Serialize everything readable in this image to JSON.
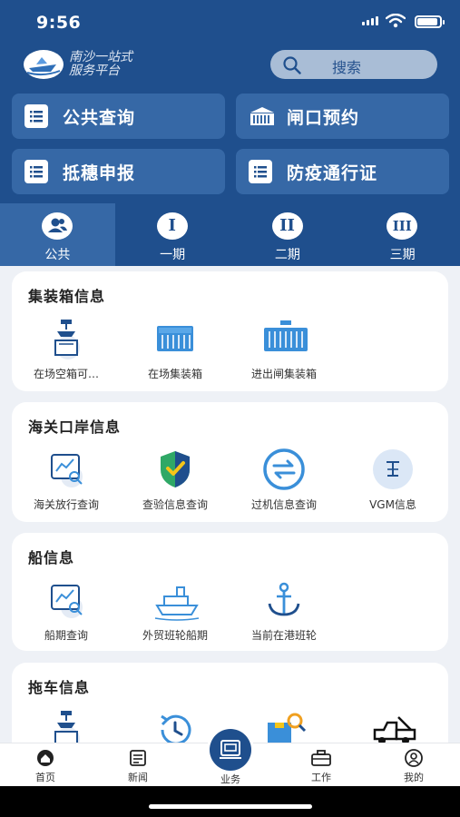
{
  "status": {
    "time": "9:56"
  },
  "brand": {
    "line1": "南沙一站式",
    "line2": "服务平台"
  },
  "search": {
    "label": "搜索"
  },
  "quick_actions": [
    {
      "label": "公共查询",
      "icon": "list-icon"
    },
    {
      "label": "闸口预约",
      "icon": "gate-icon"
    },
    {
      "label": "抵穗申报",
      "icon": "list-icon"
    },
    {
      "label": "防疫通行证",
      "icon": "list-icon"
    }
  ],
  "tabs": [
    {
      "label": "公共",
      "badge": "",
      "active": true
    },
    {
      "label": "一期",
      "badge": "I",
      "active": false
    },
    {
      "label": "二期",
      "badge": "II",
      "active": false
    },
    {
      "label": "三期",
      "badge": "III",
      "active": false
    }
  ],
  "sections": [
    {
      "title": "集装箱信息",
      "items": [
        "在场空箱可…",
        "在场集装箱",
        "进出闸集装箱"
      ]
    },
    {
      "title": "海关口岸信息",
      "items": [
        "海关放行查询",
        "查验信息查询",
        "过机信息查询",
        "VGM信息"
      ]
    },
    {
      "title": "船信息",
      "items": [
        "船期查询",
        "外贸班轮船期",
        "当前在港班轮"
      ]
    },
    {
      "title": "拖车信息",
      "items": [
        "",
        "",
        "",
        ""
      ]
    }
  ],
  "nav": {
    "home": "首页",
    "news": "新闻",
    "business": "业务",
    "work": "工作",
    "mine": "我的"
  },
  "colors": {
    "primary": "#1f4f8d",
    "header_card": "#3668a6",
    "accent": "#3a8fd9"
  }
}
